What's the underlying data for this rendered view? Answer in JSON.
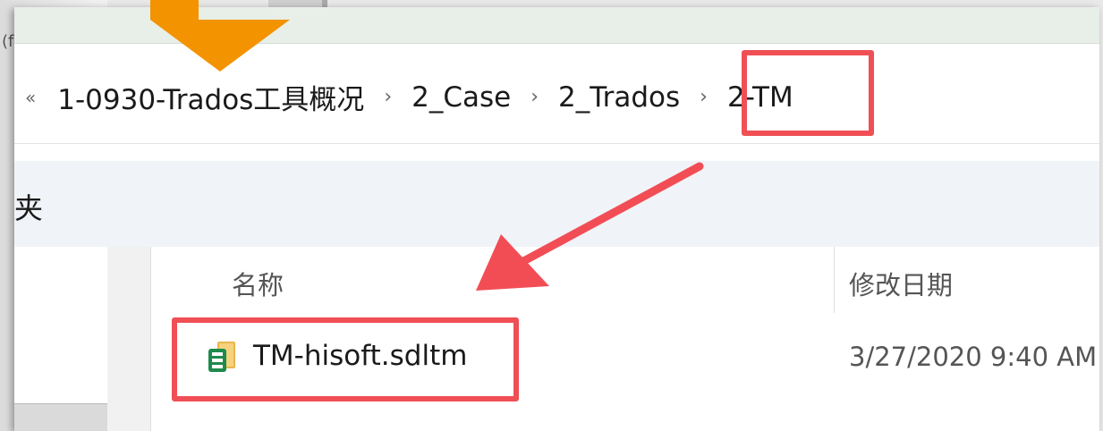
{
  "background": {
    "back_text": "(f"
  },
  "address_bar": {
    "more_glyph": "«",
    "separator": "›",
    "breadcrumbs": [
      "1-0930-Trados工具概况",
      "2_Case",
      "2_Trados",
      "2-TM"
    ]
  },
  "ribbon": {
    "title": "夹"
  },
  "list": {
    "columns": {
      "name": "名称",
      "date_modified": "修改日期"
    },
    "files": [
      {
        "name": "TM-hisoft.sdltm",
        "date_modified": "3/27/2020 9:40 AM",
        "icon": "sdltm-file-icon"
      }
    ]
  },
  "annotations": {
    "highlight_color": "#ef4f55",
    "arrow_red": "#f24d55",
    "arrow_orange": "#f39300"
  }
}
